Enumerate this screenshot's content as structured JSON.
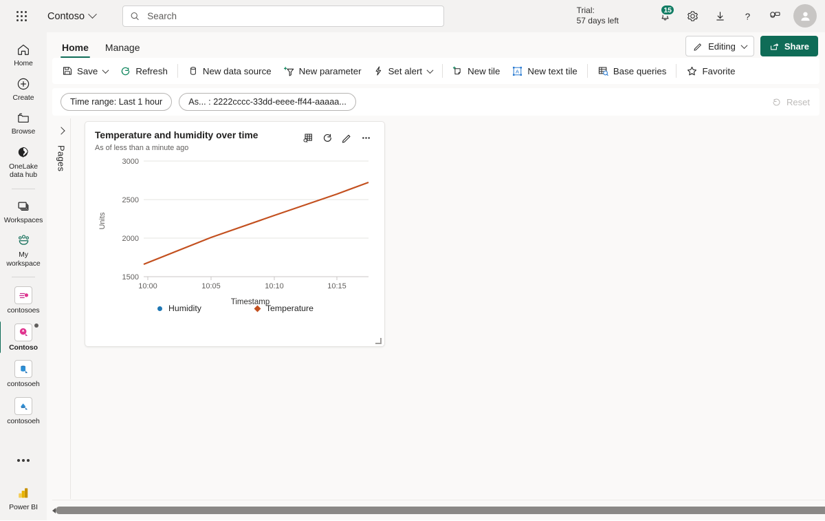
{
  "topbar": {
    "waffle_label": "app-launcher",
    "brand": "Contoso",
    "search_placeholder": "Search",
    "search_value": "",
    "trial_line1": "Trial:",
    "trial_line2": "57 days left",
    "notification_count": "15",
    "icons": [
      "notifications-icon",
      "settings-icon",
      "download-icon",
      "help-icon",
      "feedback-icon",
      "account-avatar"
    ]
  },
  "rail": {
    "items": [
      {
        "label": "Home",
        "icon": "home-icon",
        "active": false
      },
      {
        "label": "Create",
        "icon": "create-plus-icon",
        "active": false
      },
      {
        "label": "Browse",
        "icon": "browse-folder-icon",
        "active": false
      },
      {
        "label": "OneLake data hub",
        "icon": "onelake-icon",
        "active": false
      },
      {
        "label": "Workspaces",
        "icon": "workspaces-icon",
        "active": false
      },
      {
        "label": "My workspace",
        "icon": "my-workspace-icon",
        "active": false
      },
      {
        "label": "contosoes",
        "icon": "workspace-tile-icon",
        "active": false
      },
      {
        "label": "Contoso",
        "icon": "workspace-tile-icon",
        "active": true
      },
      {
        "label": "contosoeh",
        "icon": "workspace-tile-icon",
        "active": false
      },
      {
        "label": "contosoeh",
        "icon": "workspace-tile-icon",
        "active": false
      }
    ],
    "more_label": "more-options",
    "footer_label": "Power BI"
  },
  "tabs": [
    {
      "label": "Home",
      "active": true
    },
    {
      "label": "Manage",
      "active": false
    }
  ],
  "header_actions": {
    "editing_label": "Editing",
    "editing_icon": "pencil-icon",
    "share_label": "Share",
    "share_icon": "share-icon",
    "share_color": "#0f6c57"
  },
  "toolbar": {
    "save_label": "Save",
    "refresh_label": "Refresh",
    "new_data_source_label": "New data source",
    "new_parameter_label": "New parameter",
    "set_alert_label": "Set alert",
    "new_tile_label": "New tile",
    "new_text_tile_label": "New text tile",
    "base_queries_label": "Base queries",
    "favorite_label": "Favorite"
  },
  "filterbar": {
    "time_range_pill": "Time range: Last 1 hour",
    "parameter_pill": "As... : 2222cccc-33dd-eeee-ff44-aaaaa...",
    "reset_label": "Reset",
    "reset_enabled": false
  },
  "pages_panel": {
    "label": "Pages",
    "expand_icon": "chevron-right-icon"
  },
  "tile": {
    "title": "Temperature and humidity over time",
    "subtitle": "As of less than a minute ago",
    "actions": [
      "table-view-icon",
      "refresh-icon",
      "edit-pencil-icon",
      "more-options-icon"
    ]
  },
  "chart_data": {
    "type": "line",
    "title": "Temperature and humidity over time",
    "xlabel": "Timestamp",
    "ylabel": "Units",
    "xticks": [
      "10:00",
      "10:05",
      "10:10",
      "10:15"
    ],
    "yticks": [
      "1500",
      "2000",
      "2500",
      "3000"
    ],
    "ylim": [
      1500,
      3000
    ],
    "grid": true,
    "legend_position": "bottom",
    "series": [
      {
        "name": "Humidity",
        "color": "#1f77b4",
        "marker": "circle",
        "x": [],
        "values": []
      },
      {
        "name": "Temperature",
        "color": "#c3501f",
        "marker": "diamond",
        "x": [
          "09:59",
          "10:05",
          "10:10",
          "10:15",
          "10:17"
        ],
        "values": [
          1660,
          2010,
          2290,
          2570,
          2730
        ]
      }
    ]
  },
  "scrollbar": {
    "left_arrow": "scroll-left-icon",
    "right_arrow": "scroll-right-icon"
  }
}
